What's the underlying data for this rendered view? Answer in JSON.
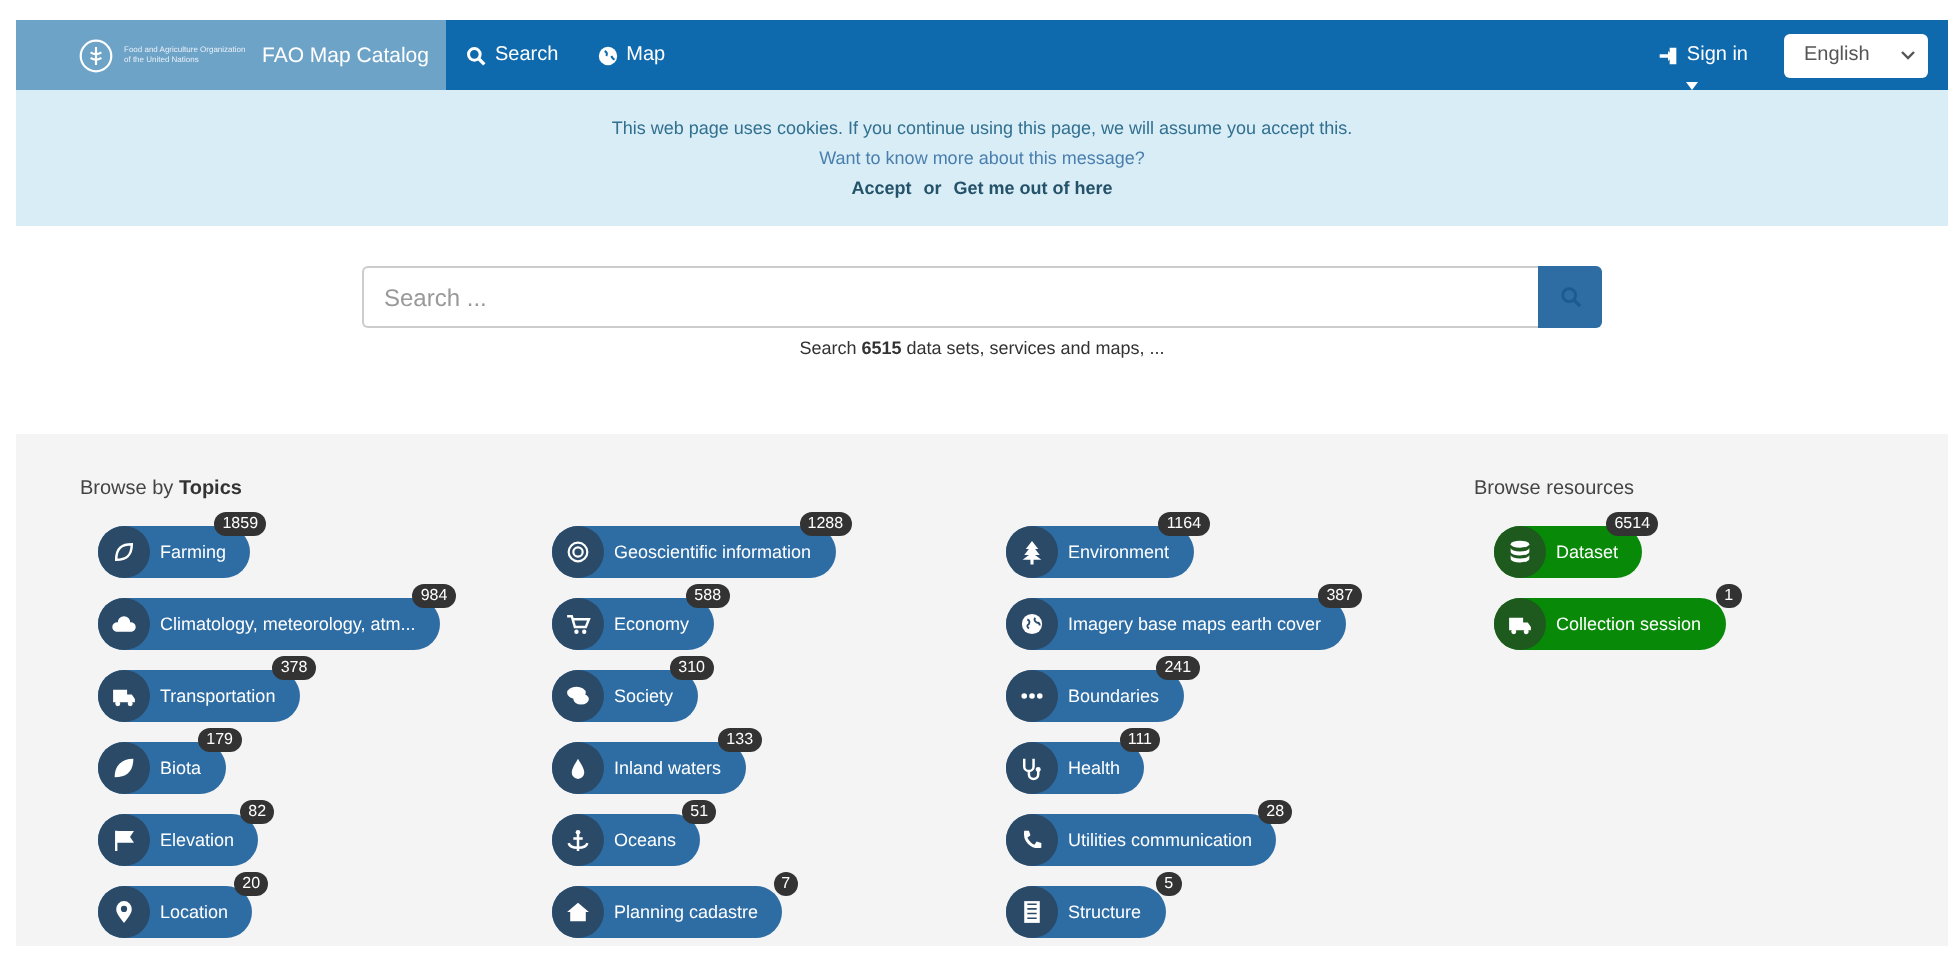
{
  "navbar": {
    "logo_text": "Food and Agriculture Organization of the United Nations",
    "brand": "FAO Map Catalog",
    "links": [
      {
        "label": "Search",
        "kind": "search"
      },
      {
        "label": "Map",
        "kind": "globe"
      }
    ],
    "sign_in": "Sign in",
    "language": "English"
  },
  "cookie_banner": {
    "message": "This web page uses cookies. If you continue using this page, we will assume you accept this.",
    "more_link": "Want to know more about this message?",
    "accept": "Accept",
    "or": "or",
    "leave": "Get me out of here"
  },
  "search": {
    "placeholder": "Search ...",
    "hint": "Search **6515** data sets, services and maps, ..."
  },
  "topics": {
    "title": "Browse by **Topics**",
    "columns": [
      [
        {
          "label": "Farming",
          "count": "1859"
        },
        {
          "label": "Climatology, meteorology, atm...",
          "count": "984"
        },
        {
          "label": "Transportation",
          "count": "378"
        },
        {
          "label": "Biota",
          "count": "179"
        },
        {
          "label": "Elevation",
          "count": "82"
        },
        {
          "label": "Location",
          "count": "20"
        }
      ],
      [
        {
          "label": "Geoscientific information",
          "count": "1288"
        },
        {
          "label": "Economy",
          "count": "588"
        },
        {
          "label": "Society",
          "count": "310"
        },
        {
          "label": "Inland waters",
          "count": "133"
        },
        {
          "label": "Oceans",
          "count": "51"
        },
        {
          "label": "Planning cadastre",
          "count": "7"
        }
      ],
      [
        {
          "label": "Environment",
          "count": "1164"
        },
        {
          "label": "Imagery base maps earth cover",
          "count": "387"
        },
        {
          "label": "Boundaries",
          "count": "241"
        },
        {
          "label": "Health",
          "count": "111"
        },
        {
          "label": "Utilities communication",
          "count": "28"
        },
        {
          "label": "Structure",
          "count": "5"
        }
      ]
    ]
  },
  "resources": {
    "title": "Browse resources",
    "items": [
      {
        "label": "Dataset",
        "count": "6514"
      },
      {
        "label": "Collection session",
        "count": "1"
      }
    ]
  }
}
